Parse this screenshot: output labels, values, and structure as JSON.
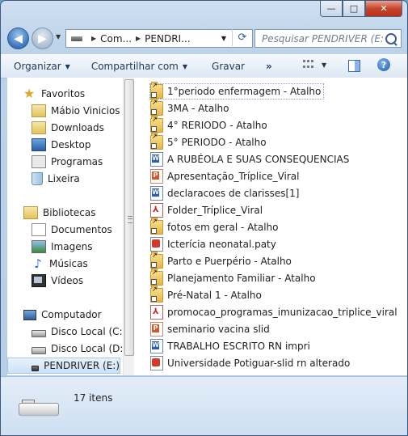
{
  "window": {
    "controls": {
      "minimize": "—",
      "maximize": "□",
      "close": "✕"
    }
  },
  "navigation": {
    "breadcrumb": [
      "Com...",
      "PENDRI..."
    ],
    "search_placeholder": "Pesquisar PENDRIVER (E:)"
  },
  "toolbar": {
    "organize": "Organizar",
    "share": "Compartilhar com",
    "burn": "Gravar",
    "more": "»"
  },
  "sidebar": {
    "favorites": {
      "label": "Favoritos",
      "items": [
        "Mábio Vinicios",
        "Downloads",
        "Desktop",
        "Programas",
        "Lixeira"
      ]
    },
    "libraries": {
      "label": "Bibliotecas",
      "items": [
        "Documentos",
        "Imagens",
        "Músicas",
        "Vídeos"
      ]
    },
    "computer": {
      "label": "Computador",
      "items": [
        "Disco Local (C:)",
        "Disco Local (D:)",
        "PENDRIVER (E:)"
      ]
    }
  },
  "files": [
    {
      "name": "1°periodo enfermagem - Atalho",
      "type": "folder-shortcut"
    },
    {
      "name": "3MA - Atalho",
      "type": "folder-shortcut"
    },
    {
      "name": "4° RERIODO - Atalho",
      "type": "folder-shortcut"
    },
    {
      "name": "5° PERIODO - Atalho",
      "type": "folder-shortcut"
    },
    {
      "name": "A RUBÉOLA E SUAS CONSEQUENCIAS",
      "type": "word"
    },
    {
      "name": "Apresentação_Tríplice_Viral",
      "type": "powerpoint"
    },
    {
      "name": "declaracoes de clarisses[1]",
      "type": "word"
    },
    {
      "name": "Folder_Tríplice_Viral",
      "type": "pdf"
    },
    {
      "name": "fotos em geral - Atalho",
      "type": "folder-shortcut"
    },
    {
      "name": "Icterícia neonatal.paty",
      "type": "paty"
    },
    {
      "name": "Parto e Puerpério - Atalho",
      "type": "folder-shortcut"
    },
    {
      "name": "Planejamento Familiar - Atalho",
      "type": "folder-shortcut"
    },
    {
      "name": "Pré-Natal 1 - Atalho",
      "type": "folder-shortcut"
    },
    {
      "name": "promocao_programas_imunizacao_triplice_viral",
      "type": "pdf"
    },
    {
      "name": "seminario vacina slid",
      "type": "powerpoint"
    },
    {
      "name": "TRABALHO ESCRITO RN impri",
      "type": "word"
    },
    {
      "name": "Universidade Potiguar-slid rn alterado",
      "type": "paty"
    }
  ],
  "status": {
    "item_count": "17 itens"
  }
}
